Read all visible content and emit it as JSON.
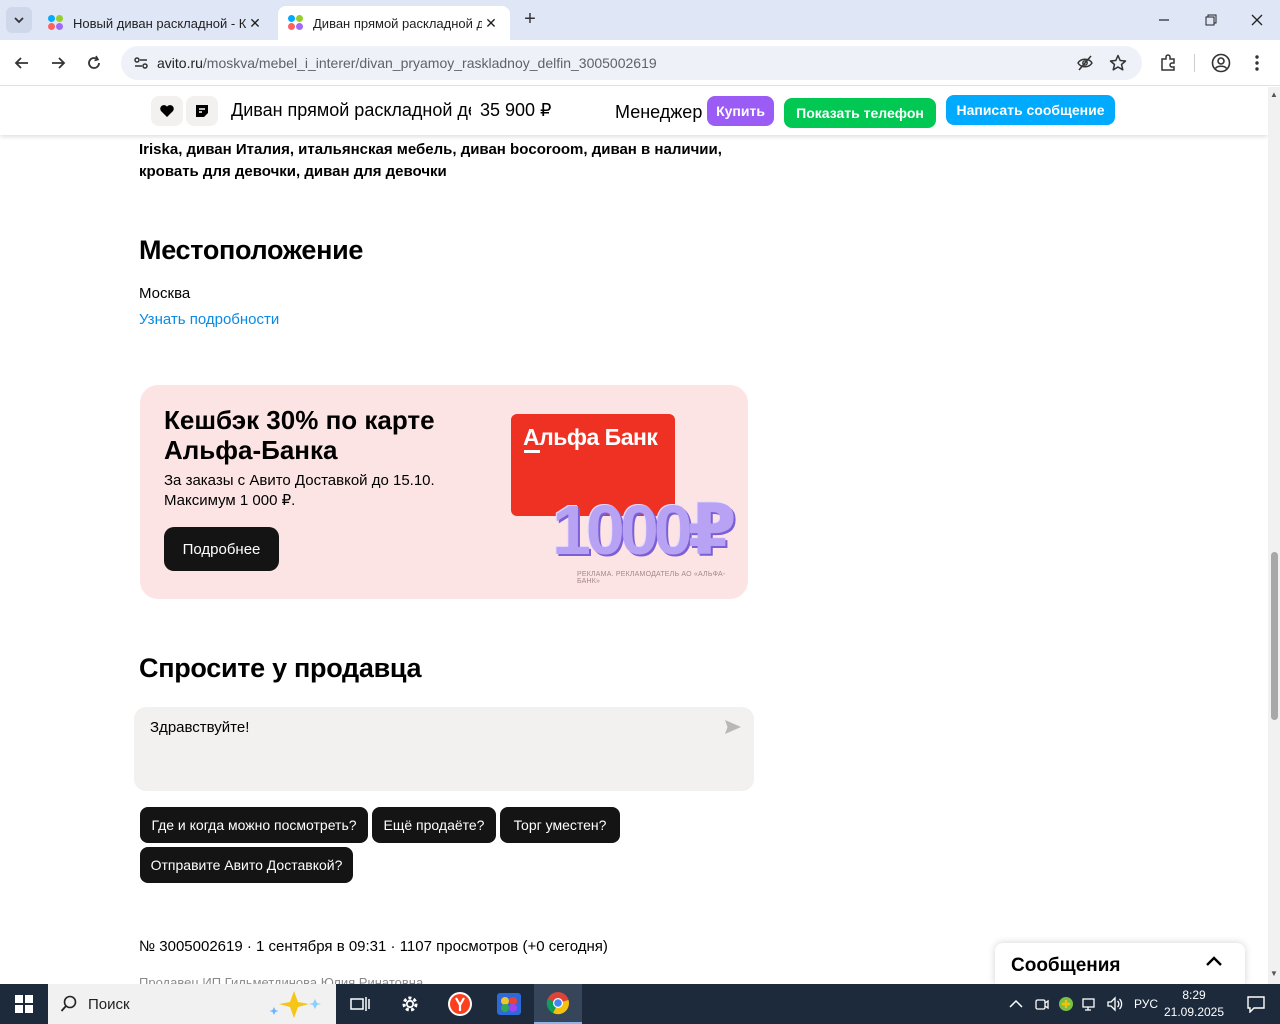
{
  "browser": {
    "tabs": [
      {
        "title": "Новый диван раскладной - Ку",
        "active": false
      },
      {
        "title": "Диван прямой раскладной де",
        "active": true
      }
    ],
    "url_host": "avito.ru",
    "url_path": "/moskva/mebel_i_interer/divan_pryamoy_raskladnoy_delfin_3005002619"
  },
  "sticky": {
    "title": "Диван прямой раскладной де...",
    "price": "35 900 ₽",
    "manager": "Менеджер",
    "buy": "Купить",
    "show_phone": "Показать телефон",
    "write": "Написать сообщение"
  },
  "tags_text": "кровать двуспальная, диван ekodesign, диван moonouse, диван manifesto, диван Iriska, диван Италия, итальянская мебель, диван bocoroom, диван в наличии, кровать для девочки, диван для девочки",
  "location": {
    "heading": "Местоположение",
    "city": "Москва",
    "details_link": "Узнать подробности"
  },
  "promo": {
    "title": "Кешбэк 30% по карте Альфа-Банка",
    "subtitle": "За заказы с Авито Доставкой до 15.10. Максимум 1 000 ₽.",
    "button": "Подробнее",
    "card_brand": "Альфа Банк",
    "amount": "1000₽",
    "ad_note": "РЕКЛАМА. РЕКЛАМОДАТЕЛЬ АО «АЛЬФА-БАНК»"
  },
  "ask": {
    "heading": "Спросите у продавца",
    "message": "Здравствуйте!",
    "chips": [
      "Где и когда можно посмотреть?",
      "Ещё продаёте?",
      "Торг уместен?",
      "Отправите Авито Доставкой?"
    ]
  },
  "meta": "№ 3005002619 · 1 сентября в 09:31 · 1107 просмотров (+0 сегодня)",
  "seller": "Продавец ИП Гильметдинова Юлия Ринатовна",
  "messages_widget": "Сообщения",
  "taskbar": {
    "search_placeholder": "Поиск",
    "lang": "РУС",
    "time": "8:29",
    "date": "21.09.2025"
  },
  "colors": {
    "accent_blue": "#00aaff",
    "buy_purple": "#9b5cf6",
    "phone_green": "#00c853",
    "link_blue": "#0a8ae6",
    "promo_bg": "#fde4e4",
    "alfa_red": "#ef3124"
  }
}
